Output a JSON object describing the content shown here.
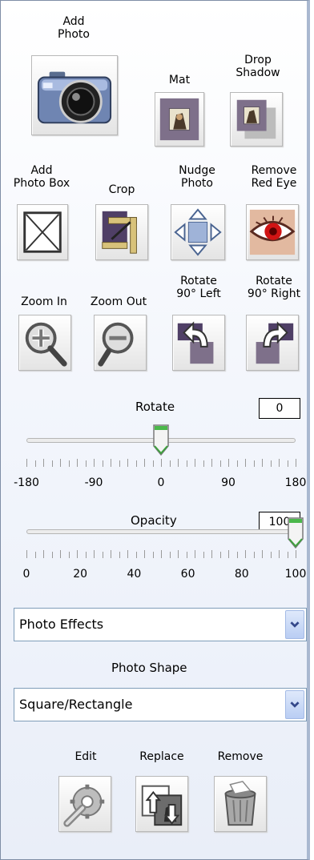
{
  "tools": {
    "add_photo": "Add\nPhoto",
    "mat": "Mat",
    "drop_shadow": "Drop\nShadow",
    "add_photo_box": "Add\nPhoto Box",
    "crop": "Crop",
    "nudge_photo": "Nudge\nPhoto",
    "remove_red_eye": "Remove\nRed Eye",
    "zoom_in": "Zoom In",
    "zoom_out": "Zoom Out",
    "rotate_left": "Rotate\n90° Left",
    "rotate_right": "Rotate\n90° Right"
  },
  "rotate": {
    "label": "Rotate",
    "value": "0",
    "min": -180,
    "max": 180,
    "current": 0,
    "tick_labels": [
      "-180",
      "-90",
      "0",
      "90",
      "180"
    ]
  },
  "opacity": {
    "label": "Opacity",
    "value": "100",
    "min": 0,
    "max": 100,
    "current": 100,
    "tick_labels": [
      "0",
      "20",
      "40",
      "60",
      "80",
      "100"
    ]
  },
  "photo_effects": {
    "selected": "Photo Effects"
  },
  "photo_shape": {
    "label": "Photo Shape",
    "selected": "Square/Rectangle"
  },
  "actions": {
    "edit": "Edit",
    "replace": "Replace",
    "remove": "Remove"
  }
}
